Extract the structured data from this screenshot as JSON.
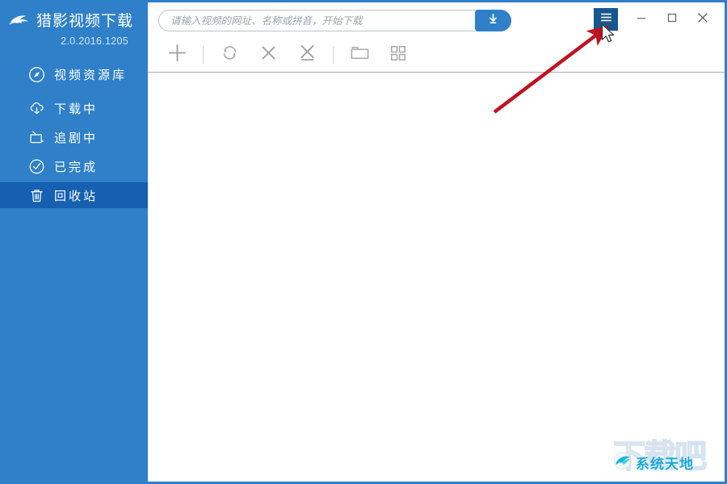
{
  "app": {
    "title": "猎影视频下载",
    "version": "2.0.2016.1205",
    "logo_icon": "swoosh-logo-icon"
  },
  "sidebar": {
    "items": [
      {
        "label": "视频资源库",
        "icon": "compass-icon",
        "active": false
      },
      {
        "label": "下载中",
        "icon": "cloud-download-icon",
        "active": false
      },
      {
        "label": "追剧中",
        "icon": "tv-icon",
        "active": false
      },
      {
        "label": "已完成",
        "icon": "check-circle-icon",
        "active": false
      },
      {
        "label": "回收站",
        "icon": "trash-icon",
        "active": true
      }
    ]
  },
  "search": {
    "placeholder": "请输入视频的网址、名称或拼音，开始下载",
    "value": "",
    "download_button_icon": "download-arrow-icon"
  },
  "window_controls": {
    "menu_label": "",
    "menu_icon": "hamburger-menu-icon",
    "minimize_icon": "minimize-icon",
    "maximize_icon": "maximize-icon",
    "close_icon": "close-icon"
  },
  "toolbar": {
    "buttons": [
      {
        "name": "add",
        "icon": "plus-icon"
      },
      {
        "name": "refresh",
        "icon": "refresh-icon"
      },
      {
        "name": "delete",
        "icon": "x-icon"
      },
      {
        "name": "delete-all",
        "icon": "x-underline-icon"
      },
      {
        "name": "open-folder",
        "icon": "folder-icon"
      },
      {
        "name": "grid-view",
        "icon": "grid-icon"
      }
    ]
  },
  "content": {
    "empty_message": ""
  },
  "watermark": {
    "ghost_text": "下载吧",
    "text": "系统天地",
    "logo_icon": "globe-swirl-icon"
  },
  "annotation": {
    "arrow_color": "#c1121f",
    "cursor_icon": "arrow-pointer-icon"
  },
  "colors": {
    "sidebar": "#2f80c8",
    "sidebar_active": "#1560b0",
    "accent": "#2f80c8",
    "menu_active": "#17568f",
    "watermark_text": "#1aa7d8"
  }
}
